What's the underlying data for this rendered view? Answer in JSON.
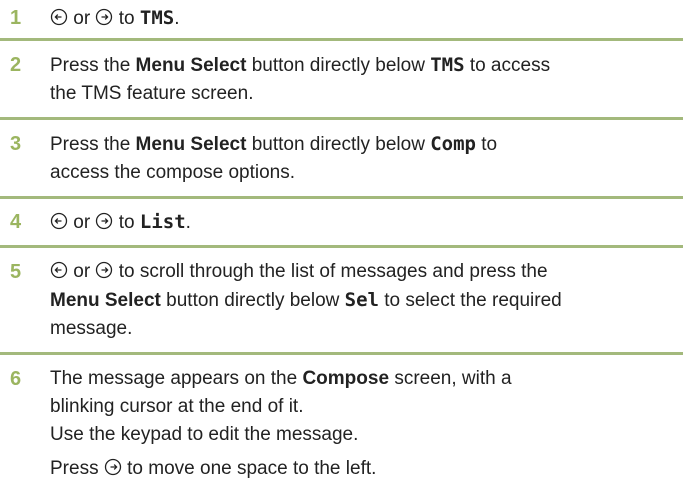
{
  "colors": {
    "step_number": "#9bb560",
    "separator": "#a3b97c",
    "text": "#222222"
  },
  "icons": {
    "left": "nav-left-icon",
    "right": "nav-right-icon"
  },
  "steps": [
    {
      "number": "1",
      "t1": "or",
      "t2": "to",
      "mono": "TMS",
      "t3": "."
    },
    {
      "number": "2",
      "t1": "Press the",
      "bold1": "Menu Select",
      "t2": "button directly below",
      "mono": "TMS",
      "t3": "to access",
      "t4": "the TMS feature screen."
    },
    {
      "number": "3",
      "t1": "Press the",
      "bold1": "Menu Select",
      "t2": "button directly below",
      "mono": "Comp",
      "t3": "to",
      "t4": "access the compose options."
    },
    {
      "number": "4",
      "t1": "or",
      "t2": "to",
      "mono": "List",
      "t3": "."
    },
    {
      "number": "5",
      "t1": "or",
      "t2": "to scroll through the list of messages and press the",
      "bold1": "Menu Select",
      "t3": "button directly below",
      "mono": "Sel",
      "t4": "to select the required",
      "t5": "message."
    },
    {
      "number": "6",
      "t1": "The message appears on the",
      "bold1": "Compose",
      "t2": "screen, with a",
      "t3": "blinking cursor at the end of it.",
      "t4": "Use the keypad to edit the message.",
      "t5": "Press",
      "t6": "to move one space to the left."
    }
  ]
}
